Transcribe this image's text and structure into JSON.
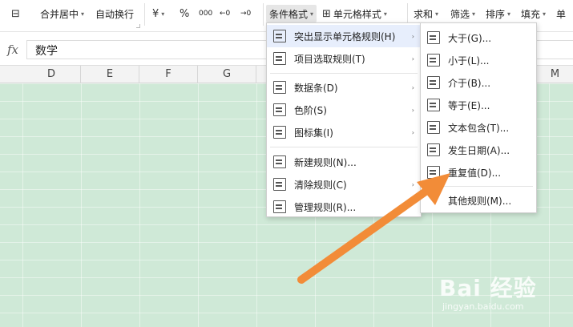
{
  "ribbon": {
    "merge_center": "合并居中",
    "auto_wrap": "自动换行",
    "currency": "¥",
    "percent": "%",
    "thousands": "000",
    "dec_inc": "←0",
    "dec_dec": "→0",
    "conditional_format": "条件格式",
    "cell_style": "单元格样式",
    "sum": "求和",
    "filter": "筛选",
    "sort": "排序",
    "fill": "填充",
    "more": "单"
  },
  "formula_bar": {
    "fx": "fx",
    "value": "数学"
  },
  "columns": [
    "D",
    "E",
    "F",
    "G",
    "M"
  ],
  "menu_main": {
    "items": [
      {
        "label": "突出显示单元格规则(H)",
        "arrow": "›"
      },
      {
        "label": "项目选取规则(T)",
        "arrow": "›"
      },
      {
        "label": "数据条(D)",
        "arrow": "›"
      },
      {
        "label": "色阶(S)",
        "arrow": "›"
      },
      {
        "label": "图标集(I)",
        "arrow": "›"
      },
      {
        "label": "新建规则(N)..."
      },
      {
        "label": "清除规则(C)",
        "arrow": "›"
      },
      {
        "label": "管理规则(R)..."
      }
    ]
  },
  "menu_sub": {
    "items": [
      {
        "label": "大于(G)..."
      },
      {
        "label": "小于(L)..."
      },
      {
        "label": "介于(B)..."
      },
      {
        "label": "等于(E)..."
      },
      {
        "label": "文本包含(T)..."
      },
      {
        "label": "发生日期(A)..."
      },
      {
        "label": "重复值(D)..."
      },
      {
        "label": "其他规则(M)..."
      }
    ]
  },
  "watermark": {
    "brand": "Bai 经验",
    "url": "jingyan.baidu.com"
  },
  "colors": {
    "sheet_bg": "#cfe9d7",
    "highlight": "#e7eefc",
    "arrow": "#f28c38"
  }
}
